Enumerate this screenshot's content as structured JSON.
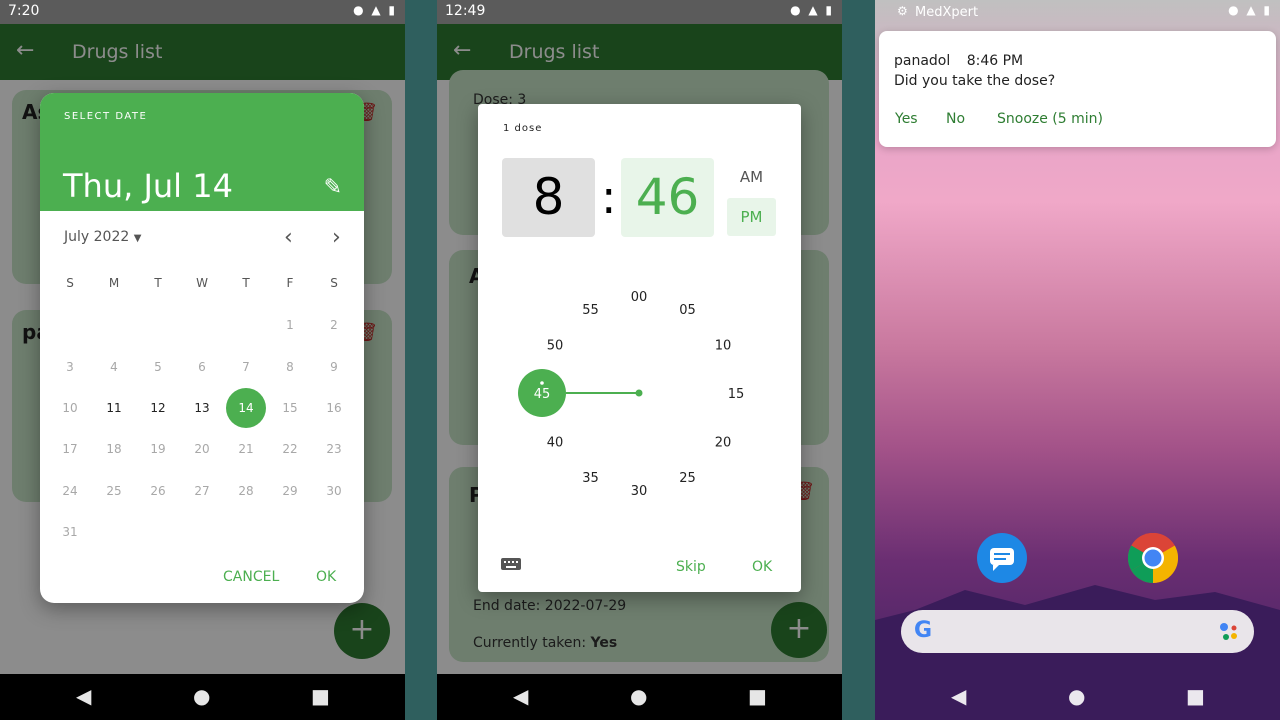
{
  "screen1": {
    "status_time": "7:20",
    "app_title": "Drugs list",
    "background_cards": [
      {
        "title": "As"
      },
      {
        "title": "pa"
      }
    ],
    "datepicker": {
      "select_label": "SELECT DATE",
      "selected_date": "Thu, Jul 14",
      "month_label": "July 2022",
      "weekdays": [
        "S",
        "M",
        "T",
        "W",
        "T",
        "F",
        "S"
      ],
      "days": [
        "1",
        "2",
        "3",
        "4",
        "5",
        "6",
        "7",
        "8",
        "9",
        "10",
        "11",
        "12",
        "13",
        "14",
        "15",
        "16",
        "17",
        "18",
        "19",
        "20",
        "21",
        "22",
        "23",
        "24",
        "25",
        "26",
        "27",
        "28",
        "29",
        "30",
        "31"
      ],
      "selected_day": "14",
      "cancel": "CANCEL",
      "ok": "OK"
    }
  },
  "screen2": {
    "status_time": "12:49",
    "app_title": "Drugs list",
    "cards": [
      {
        "line": "Dose: 3"
      },
      {
        "title": "Ac"
      },
      {
        "title": "Pa",
        "end_date": "End date: 2022-07-29",
        "taken_label": "Currently taken:",
        "taken_value": "Yes"
      }
    ],
    "timepicker": {
      "label": "1 dose",
      "hour": "8",
      "colon": ":",
      "minute": "46",
      "am": "AM",
      "pm": "PM",
      "dial": [
        "00",
        "05",
        "10",
        "15",
        "20",
        "25",
        "30",
        "35",
        "40",
        "45",
        "50",
        "55"
      ],
      "selected_tick": "45",
      "skip": "Skip",
      "ok": "OK"
    }
  },
  "screen3": {
    "notification": {
      "app_name": "MedXpert",
      "drug": "panadol",
      "time": "8:46 PM",
      "message": "Did you take the dose?",
      "actions": [
        "Yes",
        "No",
        "Snooze (5 min)"
      ]
    }
  },
  "colors": {
    "primary_dark": "#2e7d32",
    "primary": "#4caf50",
    "card": "#c8e6c9",
    "delete": "#c62828"
  }
}
